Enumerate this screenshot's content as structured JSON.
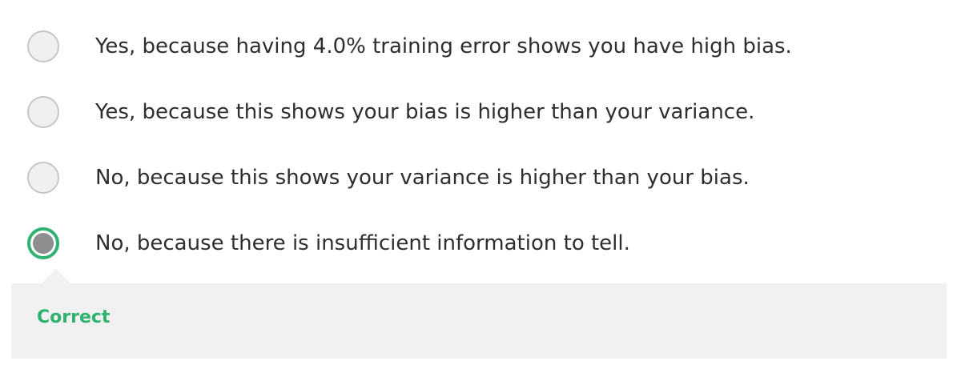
{
  "options": [
    {
      "label": "Yes, because having 4.0% training error shows you have high bias.",
      "selected": false
    },
    {
      "label": "Yes, because this shows your bias is higher than your variance.",
      "selected": false
    },
    {
      "label": "No, because this shows your variance is higher than your bias.",
      "selected": false
    },
    {
      "label": "No, because there is insufficient information to tell.",
      "selected": true
    }
  ],
  "feedback": {
    "status": "Correct"
  },
  "colors": {
    "correct": "#2fb26f",
    "radio_fill": "#f0f0f0",
    "radio_border": "#c6c6c6",
    "selected_dot": "#8e8e8e",
    "feedback_bg": "#f1f1f1"
  }
}
